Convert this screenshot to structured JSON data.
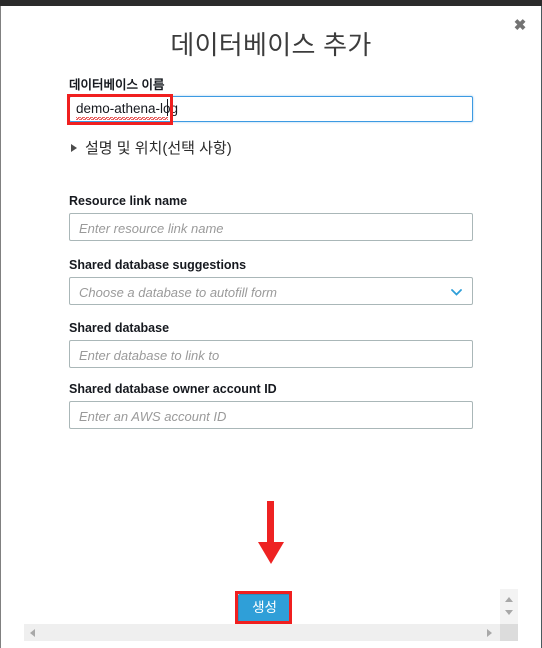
{
  "dialog": {
    "title": "데이터베이스 추가",
    "close_label": "✖"
  },
  "database_name": {
    "label": "데이터베이스 이름",
    "value": "demo-athena-log"
  },
  "collapsible": {
    "label": "설명 및 위치(선택 사항)"
  },
  "fields": [
    {
      "label": "Resource link name",
      "placeholder": "Enter resource link name",
      "type": "text"
    },
    {
      "label": "Shared database suggestions",
      "placeholder": "Choose a database to autofill form",
      "type": "select"
    },
    {
      "label": "Shared database",
      "placeholder": "Enter database to link to",
      "type": "text"
    },
    {
      "label": "Shared database owner account ID",
      "placeholder": "Enter an AWS account ID",
      "type": "text"
    }
  ],
  "submit": {
    "label": "생성"
  },
  "colors": {
    "accent_blue": "#2f9fd8",
    "focus_border": "#3d9ae2",
    "annotation_red": "#f01f1f",
    "label_text": "#16191f",
    "placeholder_text": "#9a9a9a"
  }
}
